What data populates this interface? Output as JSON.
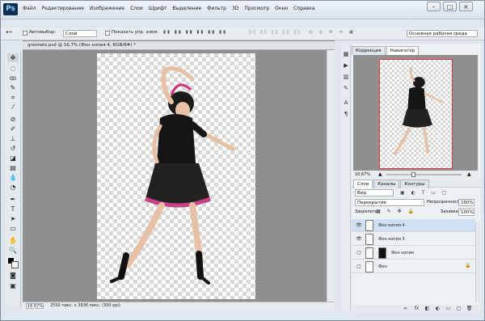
{
  "app": {
    "logo": "Ps",
    "menu": [
      "Файл",
      "Редактирование",
      "Изображение",
      "Слои",
      "Шрифт",
      "Выделение",
      "Фильтр",
      "3D",
      "Просмотр",
      "Окно",
      "Справка"
    ]
  },
  "options": {
    "autoselect_label": "Автовыбор:",
    "autoselect_value": "Слой",
    "show_controls_label": "Показать упр. элем.",
    "workspace_select": "Основная рабочая среда"
  },
  "document": {
    "tab_title": "gnomets.psd @ 16,7% (Фон копия 4, RGB/8#) *",
    "zoom": "16.67%",
    "doc_info": "2550 пикс. x 3936 пикс. (300 ppi)"
  },
  "panel_top": {
    "tabs": [
      "Коррекция",
      "Навигатор"
    ],
    "zoom": "16.67%"
  },
  "layers": {
    "tabs": [
      "Слои",
      "Каналы",
      "Контуры"
    ],
    "kind": "Вид",
    "blend_mode": "Перекрытие",
    "opacity_label": "Непрозрачность:",
    "opacity_value": "100%",
    "lock_label": "Закрепить:",
    "fill_label": "Заливка:",
    "fill_value": "100%",
    "rows": [
      {
        "name": "Фон копия 4",
        "selected": true
      },
      {
        "name": "Фон копия 3",
        "selected": false
      },
      {
        "name": "Фон копия",
        "selected": false
      },
      {
        "name": "Фон",
        "selected": false
      }
    ]
  },
  "icons": {
    "eye": "eye-icon",
    "lock": "lock-icon",
    "link": "link-icon",
    "fx": "fx-icon",
    "mask": "mask-icon",
    "adjustment": "adjustment-icon",
    "group": "folder-icon",
    "new_layer": "new-layer-icon",
    "delete": "trash-icon"
  },
  "colors": {
    "navigator_frame": "#e23b3b",
    "selection": "#cfe0f5",
    "ps_blue": "#0c2f54"
  }
}
